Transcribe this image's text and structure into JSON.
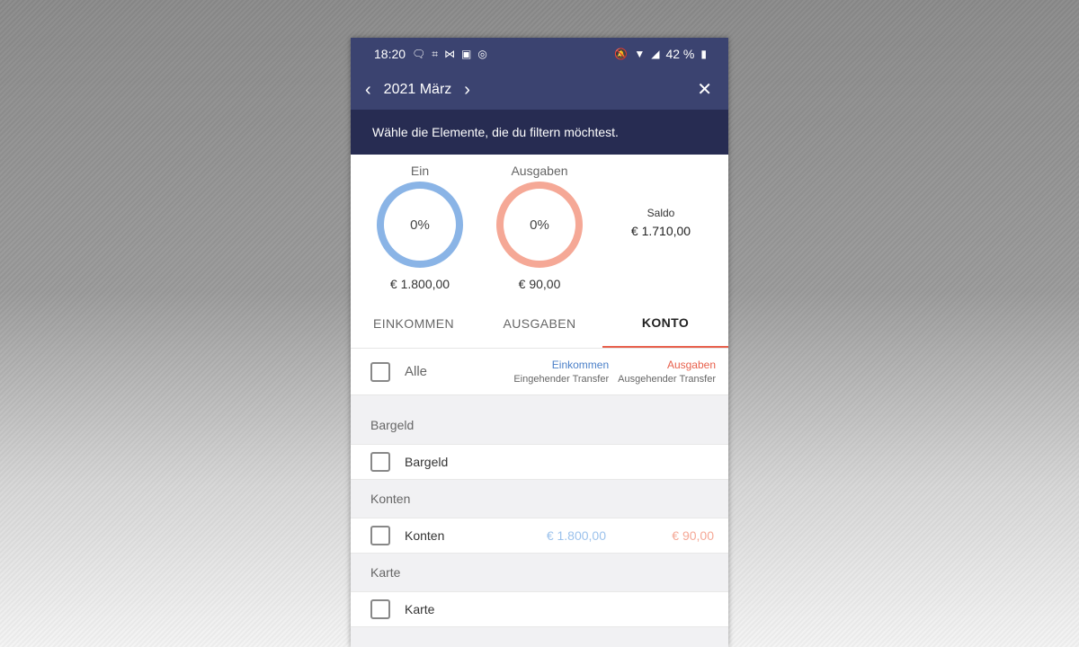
{
  "status_bar": {
    "time": "18:20",
    "left_icons": [
      "messenger-icon",
      "slack-icon",
      "gmail-icon",
      "tvp-icon",
      "instagram-icon"
    ],
    "right_icons": [
      "bell-off-icon",
      "wifi-icon",
      "signal-icon",
      "battery-icon"
    ],
    "battery": "42 %"
  },
  "app_bar": {
    "prev_icon": "chevron-left-icon",
    "month": "2021 März",
    "next_icon": "chevron-right-icon",
    "close_icon": "close-icon"
  },
  "filter_banner": {
    "text": "Wähle die Elemente, die du filtern möchtest."
  },
  "summary": {
    "income": {
      "label": "Ein",
      "percent": "0%",
      "amount": "€ 1.800,00",
      "color": "#8ab4e6"
    },
    "expense": {
      "label": "Ausgaben",
      "percent": "0%",
      "amount": "€ 90,00",
      "color": "#f5a896"
    },
    "saldo": {
      "label": "Saldo",
      "value": "€ 1.710,00"
    }
  },
  "tabs": [
    {
      "label": "EINKOMMEN",
      "active": false
    },
    {
      "label": "AUSGABEN",
      "active": false
    },
    {
      "label": "KONTO",
      "active": true
    }
  ],
  "all_row": {
    "label": "Alle",
    "legend_income": "Einkommen",
    "legend_income_sub": "Eingehender Transfer",
    "legend_expense": "Ausgaben",
    "legend_expense_sub": "Ausgehender Transfer"
  },
  "groups": [
    {
      "header": "Bargeld",
      "row": {
        "name": "Bargeld",
        "income": "",
        "expense": ""
      }
    },
    {
      "header": "Konten",
      "row": {
        "name": "Konten",
        "income": "€ 1.800,00",
        "expense": "€ 90,00"
      }
    },
    {
      "header": "Karte",
      "row": {
        "name": "Karte",
        "income": "",
        "expense": ""
      }
    }
  ],
  "colors": {
    "header_bg": "#3b4370",
    "banner_bg": "#272c52",
    "accent": "#e8604c"
  }
}
